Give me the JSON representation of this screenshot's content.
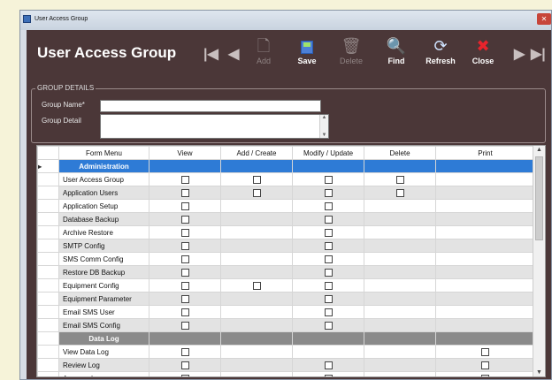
{
  "window": {
    "title": "User Access Group",
    "close_glyph": "✕"
  },
  "header": {
    "title": "User Access Group"
  },
  "toolbar": {
    "first": "|◀",
    "prev": "◀",
    "next": "▶",
    "last": "▶|",
    "buttons": [
      {
        "label": "Add",
        "icon": "add-page-icon",
        "glyph": "🗋",
        "enabled": false
      },
      {
        "label": "Save",
        "icon": "save-disk-icon",
        "glyph": "",
        "enabled": true
      },
      {
        "label": "Delete",
        "icon": "trash-icon",
        "glyph": "🗑",
        "enabled": false
      },
      {
        "label": "Find",
        "icon": "find-icon",
        "glyph": "🔍",
        "enabled": true
      },
      {
        "label": "Refresh",
        "icon": "refresh-icon",
        "glyph": "⟳",
        "enabled": true
      },
      {
        "label": "Close",
        "icon": "close-icon",
        "glyph": "✖",
        "enabled": true
      }
    ]
  },
  "group_details": {
    "legend": "GROUP DETAILS",
    "name_label": "Group Name*",
    "name_value": "",
    "detail_label": "Group Detail",
    "detail_value": ""
  },
  "grid": {
    "columns": [
      "Form Menu",
      "View",
      "Add / Create",
      "Modify / Update",
      "Delete",
      "Print"
    ],
    "rows": [
      {
        "type": "category",
        "name": "Administration",
        "selected": true
      },
      {
        "type": "item",
        "name": "User Access Group",
        "checks": [
          true,
          true,
          true,
          true,
          false
        ]
      },
      {
        "type": "item",
        "name": "Application Users",
        "checks": [
          true,
          true,
          true,
          true,
          false
        ]
      },
      {
        "type": "item",
        "name": "Application Setup",
        "checks": [
          true,
          false,
          true,
          false,
          false
        ]
      },
      {
        "type": "item",
        "name": "Database Backup",
        "checks": [
          true,
          false,
          true,
          false,
          false
        ]
      },
      {
        "type": "item",
        "name": "Archive Restore",
        "checks": [
          true,
          false,
          true,
          false,
          false
        ]
      },
      {
        "type": "item",
        "name": "SMTP Config",
        "checks": [
          true,
          false,
          true,
          false,
          false
        ]
      },
      {
        "type": "item",
        "name": "SMS Comm Config",
        "checks": [
          true,
          false,
          true,
          false,
          false
        ]
      },
      {
        "type": "item",
        "name": "Restore DB Backup",
        "checks": [
          true,
          false,
          true,
          false,
          false
        ]
      },
      {
        "type": "item",
        "name": "Equipment Config",
        "checks": [
          true,
          true,
          true,
          false,
          false
        ]
      },
      {
        "type": "item",
        "name": "Equipment Parameter",
        "checks": [
          true,
          false,
          true,
          false,
          false
        ]
      },
      {
        "type": "item",
        "name": "Email SMS User",
        "checks": [
          true,
          false,
          true,
          false,
          false
        ]
      },
      {
        "type": "item",
        "name": "Email SMS Config",
        "checks": [
          true,
          false,
          true,
          false,
          false
        ]
      },
      {
        "type": "category",
        "name": "Data Log",
        "selected": false
      },
      {
        "type": "item",
        "name": "View Data Log",
        "checks": [
          true,
          false,
          false,
          false,
          true
        ]
      },
      {
        "type": "item",
        "name": "Review Log",
        "checks": [
          true,
          false,
          true,
          false,
          true
        ]
      },
      {
        "type": "item",
        "name": "Approve Log",
        "checks": [
          true,
          false,
          true,
          false,
          true
        ]
      }
    ]
  }
}
